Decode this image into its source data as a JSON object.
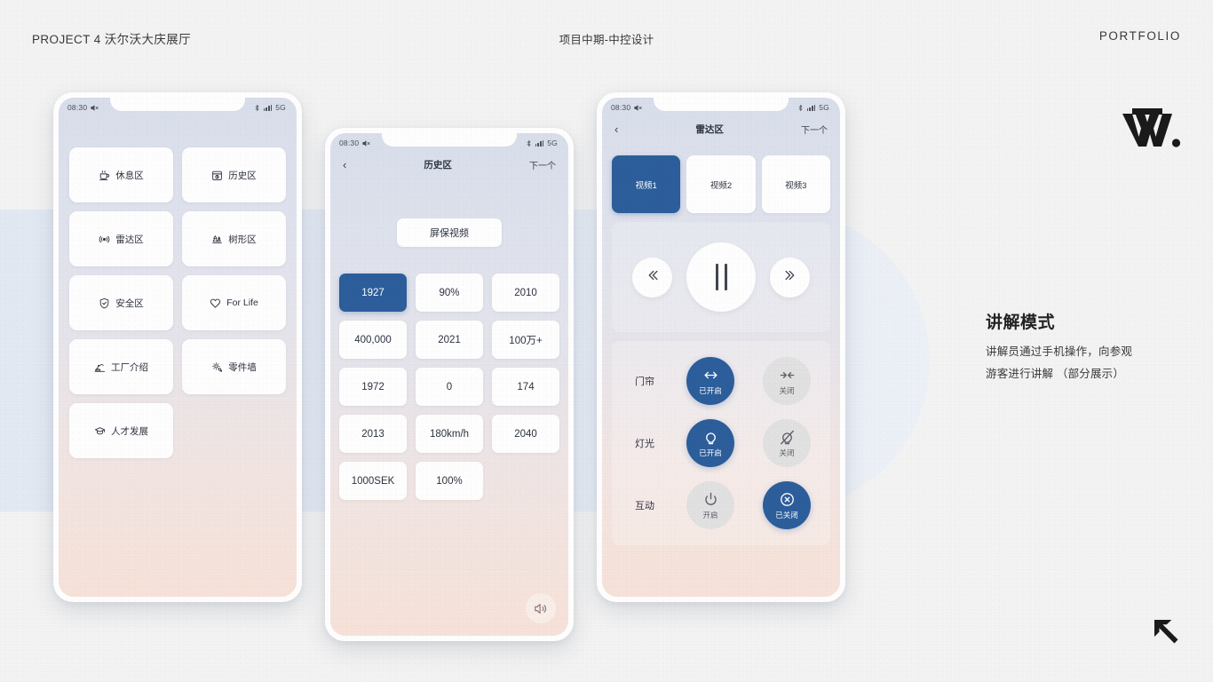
{
  "header": {
    "left": "PROJECT 4 沃尔沃大庆展厅",
    "center": "项目中期-中控设计",
    "right": "PORTFOLIO"
  },
  "brand": {
    "logo_alt": "vw-monogram-logo",
    "corner_alt": "arrow-up-left-logo"
  },
  "status_bar": {
    "time": "08:30",
    "network": "5G",
    "mute_icon": "mute-icon",
    "bluetooth_icon": "bluetooth-icon",
    "signal_icon": "signal-bars-icon"
  },
  "phone_menu": {
    "name": "menu-phone",
    "items": [
      {
        "label": "休息区",
        "icon": "coffee-cup-icon"
      },
      {
        "label": "历史区",
        "icon": "history-calendar-icon"
      },
      {
        "label": "雷达区",
        "icon": "radar-wave-icon"
      },
      {
        "label": "树形区",
        "icon": "tree-icon"
      },
      {
        "label": "安全区",
        "icon": "shield-check-icon"
      },
      {
        "label": "For Life",
        "icon": "heart-icon"
      },
      {
        "label": "工厂介绍",
        "icon": "factory-robot-icon"
      },
      {
        "label": "零件墙",
        "icon": "gear-parts-icon"
      },
      {
        "label": "人才发展",
        "icon": "graduation-cap-icon"
      }
    ]
  },
  "phone_history": {
    "name": "history-phone",
    "nav": {
      "back": "‹",
      "title": "历史区",
      "next": "下一个"
    },
    "screensaver_button": "屏保视频",
    "numbers": [
      {
        "value": "1927",
        "active": true
      },
      {
        "value": "90%",
        "active": false
      },
      {
        "value": "2010",
        "active": false
      },
      {
        "value": "400,000",
        "active": false
      },
      {
        "value": "2021",
        "active": false
      },
      {
        "value": "100万+",
        "active": false
      },
      {
        "value": "1972",
        "active": false
      },
      {
        "value": "0",
        "active": false
      },
      {
        "value": "174",
        "active": false
      },
      {
        "value": "2013",
        "active": false
      },
      {
        "value": "180km/h",
        "active": false
      },
      {
        "value": "2040",
        "active": false
      },
      {
        "value": "1000SEK",
        "active": false
      },
      {
        "value": "100%",
        "active": false
      }
    ],
    "volume_icon": "speaker-volume-icon"
  },
  "phone_radar": {
    "name": "radar-phone",
    "nav": {
      "back": "‹",
      "title": "雷达区",
      "next": "下一个"
    },
    "videos": [
      {
        "label": "视频1",
        "active": true
      },
      {
        "label": "视频2",
        "active": false
      },
      {
        "label": "视频3",
        "active": false
      }
    ],
    "media": {
      "prev_icon": "rewind-icon",
      "pause_icon": "pause-icon",
      "next_icon": "fast-forward-icon"
    },
    "controls": [
      {
        "label": "门帘",
        "icon_on": "arrows-open-icon",
        "on_label": "已开启",
        "on_active": true,
        "icon_off": "arrows-close-icon",
        "off_label": "关闭",
        "off_active": false
      },
      {
        "label": "灯光",
        "icon_on": "lightbulb-icon",
        "on_label": "已开启",
        "on_active": true,
        "icon_off": "lightbulb-off-icon",
        "off_label": "关闭",
        "off_active": false
      },
      {
        "label": "互动",
        "icon_on": "power-icon",
        "on_label": "开启",
        "on_active": false,
        "icon_off": "close-circle-icon",
        "off_label": "已关闭",
        "off_active": true
      }
    ]
  },
  "side_copy": {
    "title": "讲解模式",
    "line1": "讲解员通过手机操作，向参观",
    "line2": "游客进行讲解 （部分展示）"
  },
  "colors": {
    "accent_blue": "#2d5f9e",
    "band_blue": "#e4eaf4",
    "paper": "#f4f4f4",
    "ink": "#2b2b2b"
  }
}
